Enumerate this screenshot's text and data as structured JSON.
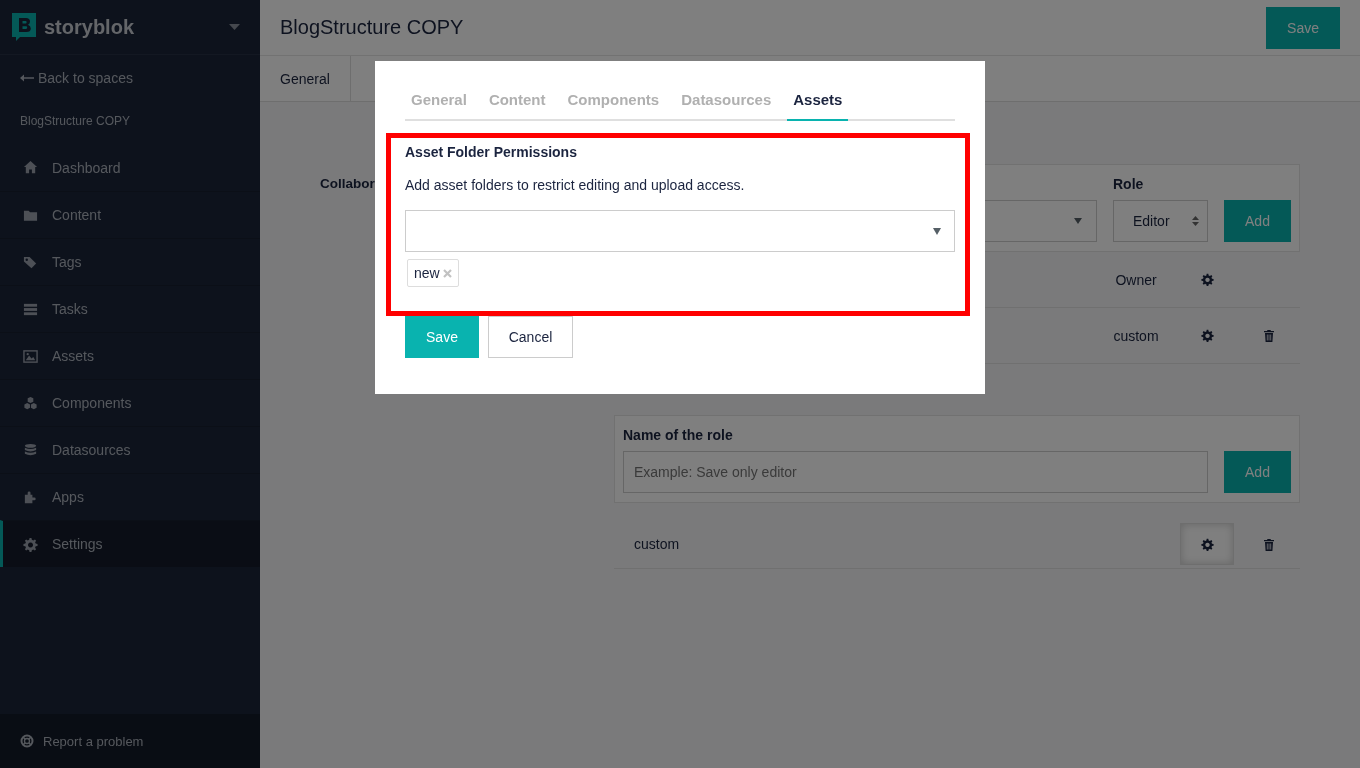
{
  "sidebar": {
    "brand": "storyblok",
    "back_link": "Back to spaces",
    "space_name": "BlogStructure COPY",
    "items": [
      {
        "label": "Dashboard",
        "kind": "home",
        "selected": false
      },
      {
        "label": "Content",
        "kind": "folder",
        "selected": false
      },
      {
        "label": "Tags",
        "kind": "tags",
        "selected": false
      },
      {
        "label": "Tasks",
        "kind": "tasks",
        "selected": false
      },
      {
        "label": "Assets",
        "kind": "image",
        "selected": false
      },
      {
        "label": "Components",
        "kind": "cubes",
        "selected": false
      },
      {
        "label": "Datasources",
        "kind": "database",
        "selected": false
      },
      {
        "label": "Apps",
        "kind": "puzzle",
        "selected": false
      },
      {
        "label": "Settings",
        "kind": "gear",
        "selected": true
      }
    ],
    "footer_link": "Report a problem"
  },
  "header": {
    "title": "BlogStructure COPY",
    "save_button": "Save"
  },
  "page_tabs": [
    {
      "label": "General"
    }
  ],
  "collaborators": {
    "label": "Collabor",
    "role_label": "Role",
    "role_select": "Editor",
    "add_button": "Add",
    "rows": [
      {
        "role": "Owner",
        "deletable": false
      },
      {
        "role": "custom",
        "deletable": true
      }
    ]
  },
  "roles": {
    "name_label": "Name of the role",
    "placeholder": "Example: Save only editor",
    "add_button": "Add",
    "rows": [
      {
        "name": "custom",
        "deletable": true
      }
    ]
  },
  "modal": {
    "tabs": [
      {
        "label": "General",
        "selected": false
      },
      {
        "label": "Content",
        "selected": false
      },
      {
        "label": "Components",
        "selected": false
      },
      {
        "label": "Datasources",
        "selected": false
      },
      {
        "label": "Assets",
        "selected": true
      }
    ],
    "heading": "Asset Folder Permissions",
    "description": "Add asset folders to restrict editing and upload access.",
    "folder_tags": [
      {
        "label": "new"
      }
    ],
    "save_button": "Save",
    "cancel_button": "Cancel"
  }
}
